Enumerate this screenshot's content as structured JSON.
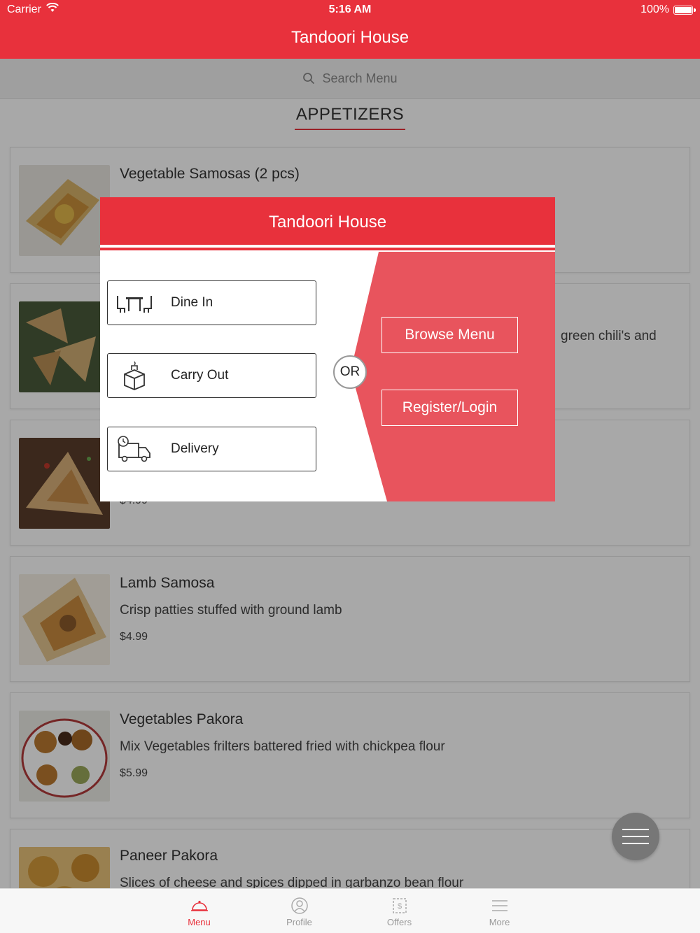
{
  "status_bar": {
    "carrier": "Carrier",
    "time": "5:16 AM",
    "battery": "100%"
  },
  "nav": {
    "title": "Tandoori House"
  },
  "search": {
    "placeholder": "Search Menu"
  },
  "section": {
    "title": "APPETIZERS"
  },
  "menu_items": [
    {
      "name": "Vegetable Samosas (2 pcs)",
      "desc": "",
      "price": ""
    },
    {
      "name": "",
      "desc": "green chili's and",
      "price": ""
    },
    {
      "name": "",
      "desc": "",
      "price": "$4.99"
    },
    {
      "name": "Lamb Samosa",
      "desc": "Crisp patties stuffed with ground lamb",
      "price": "$4.99"
    },
    {
      "name": "Vegetables Pakora",
      "desc": "Mix Vegetables frilters battered fried with chickpea flour",
      "price": "$5.99"
    },
    {
      "name": "Paneer Pakora",
      "desc": "Slices of cheese and spices dipped in garbanzo bean flour",
      "price": ""
    }
  ],
  "modal": {
    "title": "Tandoori House",
    "options": [
      {
        "label": "Dine In",
        "icon": "dine-in-table-icon"
      },
      {
        "label": "Carry Out",
        "icon": "carry-out-box-icon"
      },
      {
        "label": "Delivery",
        "icon": "delivery-truck-icon"
      }
    ],
    "or_label": "OR",
    "browse_label": "Browse Menu",
    "register_label": "Register/Login"
  },
  "tabs": [
    {
      "label": "Menu",
      "icon": "cloche-icon",
      "active": true
    },
    {
      "label": "Profile",
      "icon": "profile-icon",
      "active": false
    },
    {
      "label": "Offers",
      "icon": "offers-icon",
      "active": false
    },
    {
      "label": "More",
      "icon": "more-icon",
      "active": false
    }
  ],
  "colors": {
    "brand_red": "#e8313c",
    "modal_panel_red": "#e8545d",
    "dim_overlay": "rgba(0,0,0,0.34)"
  }
}
